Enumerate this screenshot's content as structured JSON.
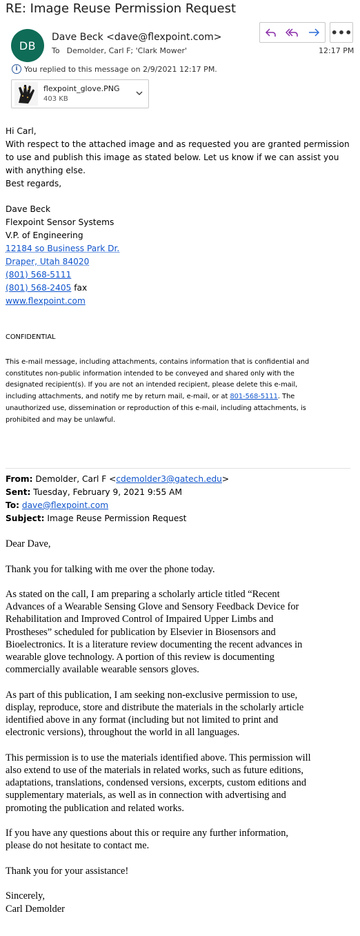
{
  "message": {
    "subject": "RE: Image Reuse Permission Request",
    "avatar_initials": "DB",
    "sender": "Dave Beck <dave@flexpoint.com>",
    "to_label": "To",
    "recipients": "Demolder, Carl F; 'Clark Mower'",
    "time": "12:17 PM",
    "replied_notice": "You replied to this message on 2/9/2021 12:17 PM.",
    "accent_color": "#0f6c57"
  },
  "actions": {
    "reply_icon": "reply-icon",
    "reply_all_icon": "reply-all-icon",
    "forward_icon": "forward-icon",
    "more_label": "•••"
  },
  "attachment": {
    "name": "flexpoint_glove.PNG",
    "size": "403 KB"
  },
  "reply_body": {
    "greeting": "Hi Carl,",
    "lines": [
      "With respect to the attached image and as requested you are granted permission",
      "to use and publish this image as stated below.  Let us know if we can assist you",
      "with anything else."
    ],
    "closing": "Best regards,",
    "signature": {
      "name": "Dave Beck",
      "company": "Flexpoint Sensor Systems",
      "title": "V.P. of Engineering",
      "address1": "12184 so Business Park Dr.",
      "address2": "Draper, Utah 84020",
      "phone": "(801) 568-5111",
      "fax_number": "(801) 568-2405",
      "fax_label": " fax",
      "website": "www.flexpoint.com"
    }
  },
  "confidential": {
    "heading": "CONFIDENTIAL",
    "lines": [
      "This e-mail message, including attachments, contains information that is confidential and",
      "constitutes non-public information intended to be conveyed and shared only with the",
      "designated recipient(s). If you are not an intended recipient, please delete this e-mail,"
    ],
    "line4_before": "including attachments, and notify me by return mail, e-mail, or at ",
    "line4_phone": "801-568-5111",
    "line4_after": ". The",
    "lines_end": [
      "unauthorized use, dissemination or reproduction of this e-mail, including attachments, is",
      "prohibited and may be unlawful."
    ]
  },
  "original_header": {
    "from_label": "From:",
    "from_name": " Demolder, Carl F <",
    "from_email": "cdemolder3@gatech.edu",
    "from_end": ">",
    "sent_label": "Sent:",
    "sent_value": " Tuesday, February 9, 2021 9:55 AM",
    "to_label": "To:",
    "to_email": "dave@flexpoint.com",
    "subject_label": "Subject:",
    "subject_value": " Image Reuse Permission Request"
  },
  "original_body": {
    "salutation": "Dear Dave,",
    "p1": [
      "Thank you for talking with me over the phone today."
    ],
    "p2": [
      "As stated on the call, I am preparing a scholarly article titled “Recent",
      "Advances of a Wearable Sensing Glove and Sensory Feedback Device for",
      "Rehabilitation and Improved Control of Impaired Upper Limbs and",
      "Prostheses” scheduled for publication by Elsevier in Biosensors and",
      "Bioelectronics. It is a literature review documenting the recent advances in",
      "wearable glove technology. A portion of this review is documenting",
      "commercially available wearable sensors gloves."
    ],
    "p3": [
      "As part of this publication, I am seeking non-exclusive permission to use,",
      "display, reproduce, store and distribute the materials in the scholarly article",
      "identified above in any format (including but not limited to print and",
      "electronic versions), throughout the world in all languages."
    ],
    "p4": [
      "This permission is to use the materials identified above. This permission will",
      "also extend to use of the materials in related works, such as future editions,",
      "adaptations, translations, condensed versions, excerpts, custom editions and",
      "supplementary materials, as well as in connection with advertising and",
      "promoting the publication and related works."
    ],
    "p5": [
      "If you have any questions about this or require any further information,",
      "please do not hesitate to contact me."
    ],
    "p6": [
      "Thank you for your assistance!"
    ],
    "signoff": "Sincerely,",
    "name": "Carl Demolder"
  }
}
